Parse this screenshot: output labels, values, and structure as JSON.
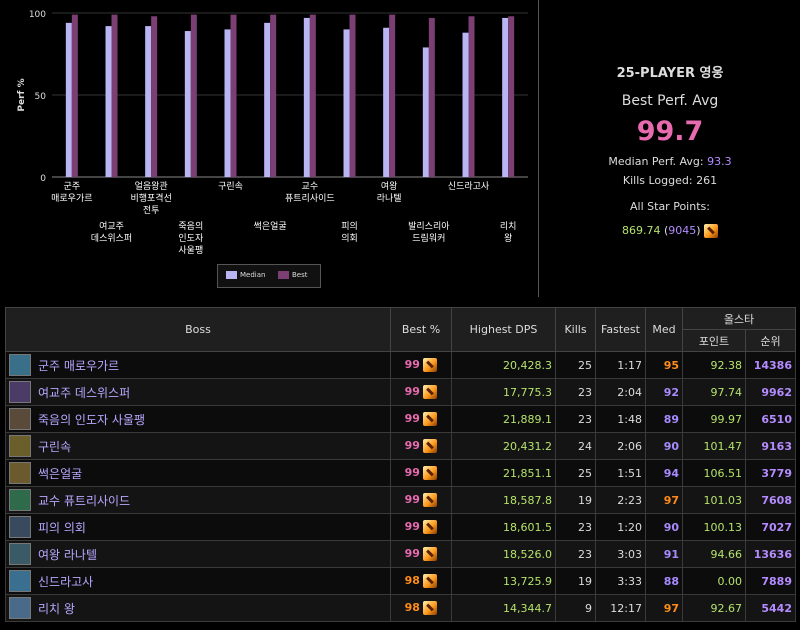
{
  "chart_data": {
    "type": "bar",
    "ylabel": "Perf %",
    "ylim": [
      0,
      100
    ],
    "yticks": [
      "0",
      "50",
      "100"
    ],
    "grid": true,
    "categories_top": [
      "군주\n매로우가르",
      "얼음왕관\n비행포격선\n전투",
      "구린속",
      "교수\n퓨트리사이드",
      "여왕\n라나텔",
      "신드라고사"
    ],
    "categories_bottom": [
      "여교주\n데스위스퍼",
      "죽음의\n인도자\n사울팽",
      "썩은얼굴",
      "피의\n의회",
      "발리스리아\n드림워커",
      "리치\n왕"
    ],
    "series": [
      {
        "name": "Median",
        "color": "#b9b5f2",
        "values": [
          94,
          92,
          92,
          89,
          90,
          94,
          97,
          90,
          91,
          79,
          88,
          97
        ]
      },
      {
        "name": "Best",
        "color": "#7b3f73",
        "values": [
          99,
          99,
          98,
          99,
          99,
          99,
          99,
          99,
          99,
          97,
          98,
          98
        ]
      }
    ],
    "legend": "bottom"
  },
  "summary": {
    "title": "25-PLAYER 영웅",
    "subtitle": "Best Perf. Avg",
    "best_avg": "99.7",
    "median_label": "Median Perf. Avg:",
    "median_value": "93.3",
    "kills_label": "Kills Logged:",
    "kills_value": "261",
    "allstar_label": "All Star Points:",
    "allstar_points": "869.74",
    "allstar_rank": "9045"
  },
  "table": {
    "headers": {
      "boss": "Boss",
      "best": "Best %",
      "dps": "Highest DPS",
      "kills": "Kills",
      "fastest": "Fastest",
      "med": "Med",
      "allstar": "올스타",
      "points": "포인트",
      "rank": "순위"
    },
    "icon_colors": [
      "#3a6f8a",
      "#4a3c66",
      "#5a4a3a",
      "#6a5e2a",
      "#6b5a2e",
      "#2f6a4a",
      "#3a4a5e",
      "#3a5a66",
      "#3a6f8f",
      "#4a6a8a"
    ],
    "rows": [
      {
        "boss": "군주 매로우가르",
        "best": "99",
        "best_tier": "pink",
        "dps": "20,428.3",
        "kills": "25",
        "fastest": "1:17",
        "med": "95",
        "med_tier": "orange",
        "points": "92.38",
        "rank": "14386"
      },
      {
        "boss": "여교주 데스위스퍼",
        "best": "99",
        "best_tier": "pink",
        "dps": "17,775.3",
        "kills": "23",
        "fastest": "2:04",
        "med": "92",
        "med_tier": "purple",
        "points": "97.74",
        "rank": "9962"
      },
      {
        "boss": "죽음의 인도자 사울팽",
        "best": "99",
        "best_tier": "pink",
        "dps": "21,889.1",
        "kills": "23",
        "fastest": "1:48",
        "med": "89",
        "med_tier": "purple",
        "points": "99.97",
        "rank": "6510"
      },
      {
        "boss": "구린속",
        "best": "99",
        "best_tier": "pink",
        "dps": "20,431.2",
        "kills": "24",
        "fastest": "2:06",
        "med": "90",
        "med_tier": "purple",
        "points": "101.47",
        "rank": "9163"
      },
      {
        "boss": "썩은얼굴",
        "best": "99",
        "best_tier": "pink",
        "dps": "21,851.1",
        "kills": "25",
        "fastest": "1:51",
        "med": "94",
        "med_tier": "purple",
        "points": "106.51",
        "rank": "3779"
      },
      {
        "boss": "교수 퓨트리사이드",
        "best": "99",
        "best_tier": "pink",
        "dps": "18,587.8",
        "kills": "19",
        "fastest": "2:23",
        "med": "97",
        "med_tier": "orange",
        "points": "101.03",
        "rank": "7608"
      },
      {
        "boss": "피의 의회",
        "best": "99",
        "best_tier": "pink",
        "dps": "18,601.5",
        "kills": "23",
        "fastest": "1:20",
        "med": "90",
        "med_tier": "purple",
        "points": "100.13",
        "rank": "7027"
      },
      {
        "boss": "여왕 라나텔",
        "best": "99",
        "best_tier": "pink",
        "dps": "18,526.0",
        "kills": "23",
        "fastest": "3:03",
        "med": "91",
        "med_tier": "purple",
        "points": "94.66",
        "rank": "13636"
      },
      {
        "boss": "신드라고사",
        "best": "98",
        "best_tier": "orange",
        "dps": "13,725.9",
        "kills": "19",
        "fastest": "3:33",
        "med": "88",
        "med_tier": "purple",
        "points": "0.00",
        "rank": "7889"
      },
      {
        "boss": "리치 왕",
        "best": "98",
        "best_tier": "orange",
        "dps": "14,344.7",
        "kills": "9",
        "fastest": "12:17",
        "med": "97",
        "med_tier": "orange",
        "points": "92.67",
        "rank": "5442"
      }
    ]
  }
}
